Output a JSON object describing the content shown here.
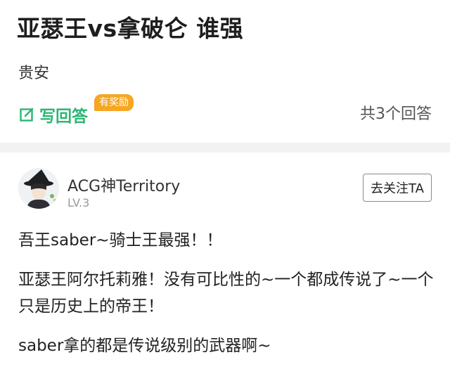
{
  "question": {
    "title": "亚瑟王vs拿破仑 谁强",
    "description": "贵安",
    "write_answer_label": "写回答",
    "reward_badge": "有奖励",
    "answer_count": "共3个回答",
    "write_icon": "edit-icon"
  },
  "answer": {
    "user_name": "ACG神Territory",
    "user_level": "LV.3",
    "follow_label": "去关注TA",
    "paragraphs": [
      "吾王saber~骑士王最强！！",
      "亚瑟王阿尔托莉雅！没有可比性的~一个都成传说了~一个只是历史上的帝王！",
      "saber拿的都是传说级别的武器啊~"
    ]
  },
  "colors": {
    "accent_green": "#2bb673",
    "reward_orange": "#f5a623",
    "divider": "#f2f2f2"
  }
}
